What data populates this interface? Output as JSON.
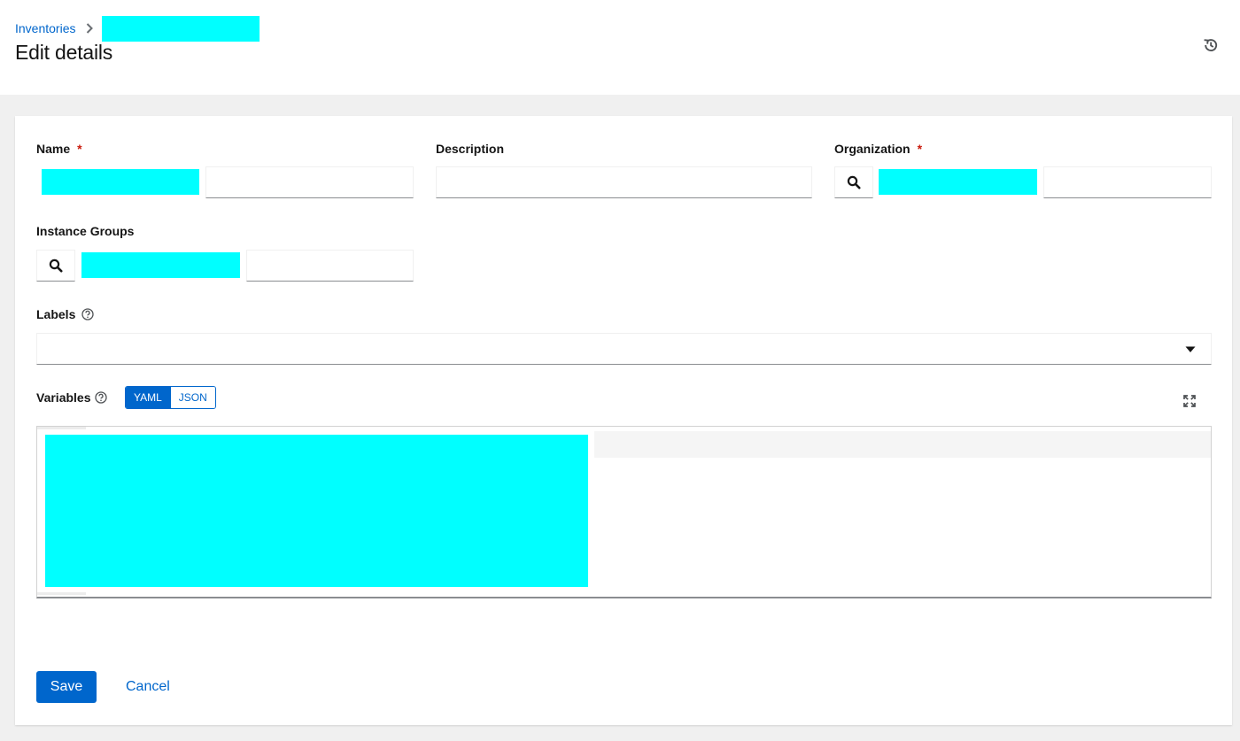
{
  "breadcrumb": {
    "parent": "Inventories",
    "separator_icon": "chevron-right-icon"
  },
  "page": {
    "title": "Edit details",
    "history_icon": "history-icon"
  },
  "form": {
    "name": {
      "label": "Name",
      "required_marker": "*"
    },
    "description": {
      "label": "Description"
    },
    "organization": {
      "label": "Organization",
      "required_marker": "*"
    },
    "instance_groups": {
      "label": "Instance Groups"
    },
    "labels": {
      "label": "Labels"
    },
    "variables": {
      "label": "Variables",
      "modes": [
        "YAML",
        "JSON"
      ],
      "selected_mode": "YAML"
    }
  },
  "actions": {
    "save_label": "Save",
    "cancel_label": "Cancel"
  },
  "colors": {
    "accent": "#0066cc",
    "required": "#c9190b",
    "redaction": "#00ffff"
  }
}
